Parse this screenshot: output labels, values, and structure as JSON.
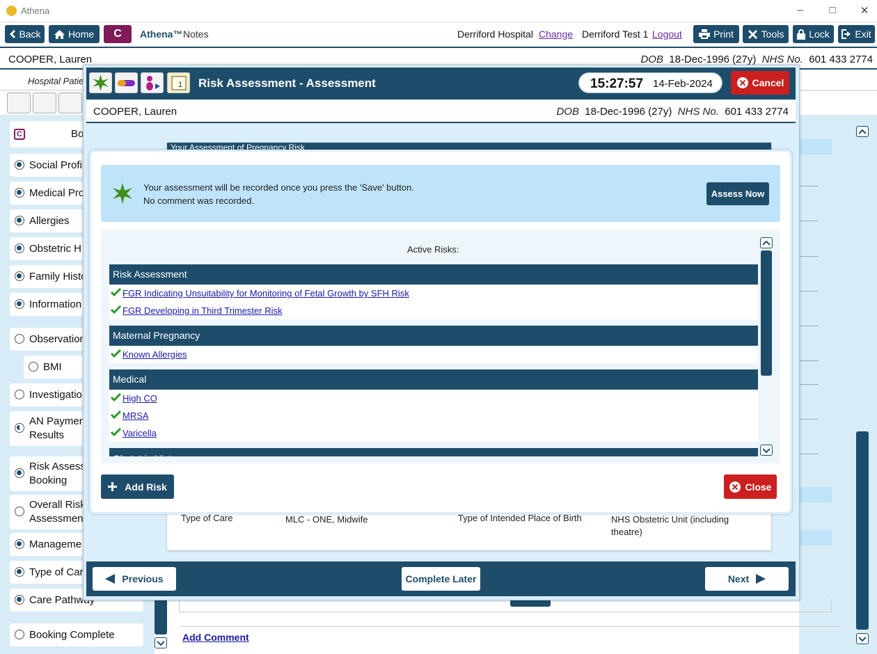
{
  "window": {
    "title": "Athena"
  },
  "nav": {
    "back": "Back",
    "home": "Home",
    "c_badge": "C",
    "app_name": "Athena™",
    "app_section": "Notes",
    "hospital": "Derriford Hospital",
    "change": "Change",
    "user": "Derriford Test 1",
    "logout": "Logout",
    "print": "Print",
    "tools": "Tools",
    "lock": "Lock",
    "exit": "Exit"
  },
  "patient": {
    "name": "COOPER, Lauren",
    "dob_label": "DOB",
    "dob": "18-Dec-1996 (27y)",
    "nhs_label": "NHS No.",
    "nhs": "601 433 2774"
  },
  "subbar": {
    "hospital_partial": "Hospital Patie"
  },
  "sidebar": {
    "c_label": "C",
    "header_partial": "Bo",
    "items": [
      {
        "label": "Social Profil",
        "state": "on"
      },
      {
        "label": "Medical Pro",
        "state": "on"
      },
      {
        "label": "Allergies",
        "state": "on"
      },
      {
        "label": "Obstetric H",
        "state": "on"
      },
      {
        "label": "Family Histo",
        "state": "on"
      },
      {
        "label": "Information",
        "state": "on"
      },
      {
        "label": "Observation",
        "state": "off"
      },
      {
        "label": "BMI",
        "state": "off"
      },
      {
        "label": "Investigatio",
        "state": "off"
      },
      {
        "label": "AN Paymen Results",
        "state": "half"
      },
      {
        "label": "Risk Assess Booking",
        "state": "on"
      },
      {
        "label": "Overall Risk Assessment",
        "state": "off"
      },
      {
        "label": "Manageme",
        "state": "on"
      },
      {
        "label": "Type of Car",
        "state": "on"
      },
      {
        "label": "Care Pathway",
        "state": "on"
      },
      {
        "label": "Booking Complete",
        "state": "off"
      }
    ]
  },
  "modal": {
    "title": "Risk Assessment - Assessment",
    "time": "15:27:57",
    "date": "14-Feb-2024",
    "cancel": "Cancel",
    "bg_section_title": "Your Assessment of Pregnancy Risk",
    "info_line1": "Your assessment will be recorded once you press the 'Save' button.",
    "info_line2": "No comment was recorded.",
    "assess_now": "Assess Now",
    "active_risks_label": "Active Risks:",
    "sections": [
      {
        "title": "Risk Assessment",
        "items": [
          "FGR Indicating Unsuitability for Monitoring of Fetal Growth by SFH Risk",
          "FGR Developing in Third Trimester Risk"
        ]
      },
      {
        "title": "Maternal Pregnancy",
        "items": [
          "Known Allergies"
        ]
      },
      {
        "title": "Medical",
        "items": [
          "High CO",
          "MRSA",
          "Varicella"
        ]
      },
      {
        "title": "Obstetric History",
        "items": []
      }
    ],
    "add_risk": "Add Risk",
    "close": "Close",
    "previous": "Previous",
    "complete_later": "Complete Later",
    "next": "Next"
  },
  "care": {
    "type_label": "Type of Care",
    "type_value": "MLC - ONE, Midwife",
    "place_label": "Type of  Intended Place of Birth",
    "place_value": "NHS Obstetric Unit (including theatre)"
  },
  "main": {
    "add_comment": "Add Comment"
  },
  "colors": {
    "primary": "#1e4d6b",
    "danger": "#cc1f1f",
    "accent_purple": "#7e1b58",
    "panel_bg": "#d8ecf7"
  }
}
